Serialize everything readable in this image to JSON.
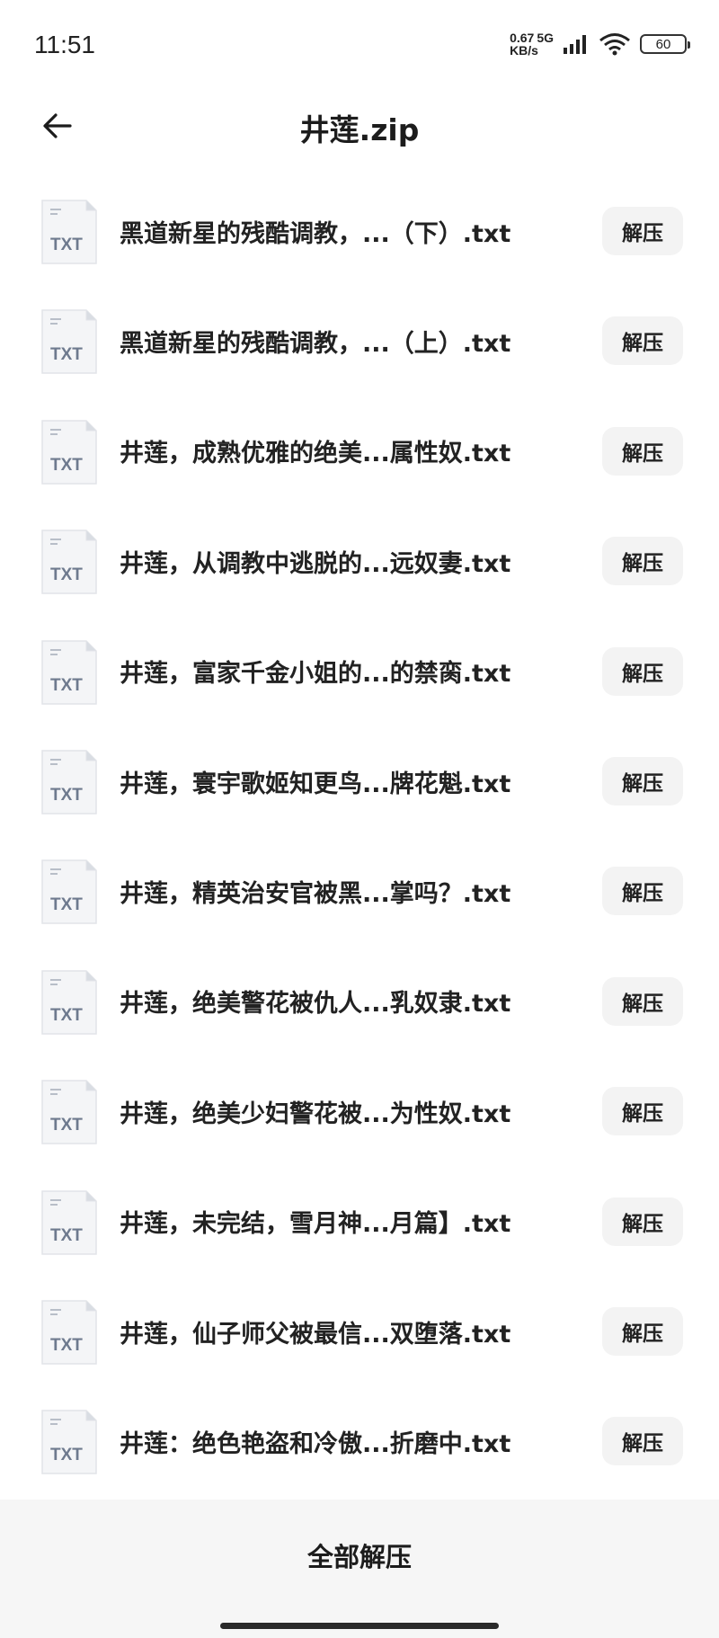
{
  "status_bar": {
    "time": "11:51",
    "net_speed_value": "0.67",
    "net_type": "5G",
    "net_speed_unit": "KB/s",
    "battery": "60"
  },
  "header": {
    "title": "井莲.zip"
  },
  "files": [
    {
      "icon_label": "TXT",
      "name": "黑道新星的残酷调教，...（下）.txt",
      "action_label": "解压"
    },
    {
      "icon_label": "TXT",
      "name": "黑道新星的残酷调教，...（上）.txt",
      "action_label": "解压"
    },
    {
      "icon_label": "TXT",
      "name": "井莲，成熟优雅的绝美...属性奴.txt",
      "action_label": "解压"
    },
    {
      "icon_label": "TXT",
      "name": "井莲，从调教中逃脱的...远奴妻.txt",
      "action_label": "解压"
    },
    {
      "icon_label": "TXT",
      "name": "井莲，富家千金小姐的...的禁脔.txt",
      "action_label": "解压"
    },
    {
      "icon_label": "TXT",
      "name": "井莲，寰宇歌姬知更鸟...牌花魁.txt",
      "action_label": "解压"
    },
    {
      "icon_label": "TXT",
      "name": "井莲，精英治安官被黑...掌吗？.txt",
      "action_label": "解压"
    },
    {
      "icon_label": "TXT",
      "name": "井莲，绝美警花被仇人...乳奴隶.txt",
      "action_label": "解压"
    },
    {
      "icon_label": "TXT",
      "name": "井莲，绝美少妇警花被...为性奴.txt",
      "action_label": "解压"
    },
    {
      "icon_label": "TXT",
      "name": "井莲，未完结，雪月神...月篇】.txt",
      "action_label": "解压"
    },
    {
      "icon_label": "TXT",
      "name": "井莲，仙子师父被最信...双堕落.txt",
      "action_label": "解压"
    },
    {
      "icon_label": "TXT",
      "name": "井莲：绝色艳盗和冷傲...折磨中.txt",
      "action_label": "解压"
    }
  ],
  "bottom": {
    "extract_all_label": "全部解压"
  },
  "icons": {
    "back": "arrow-left-icon",
    "signal": "signal-icon",
    "wifi": "wifi-icon",
    "battery": "battery-icon",
    "file": "txt-file-icon"
  },
  "colors": {
    "file_icon_bg": "#f4f5f7",
    "file_icon_label": "#6e7a8e",
    "button_bg": "#f3f3f3",
    "bottom_bar_bg": "#f6f6f6"
  }
}
